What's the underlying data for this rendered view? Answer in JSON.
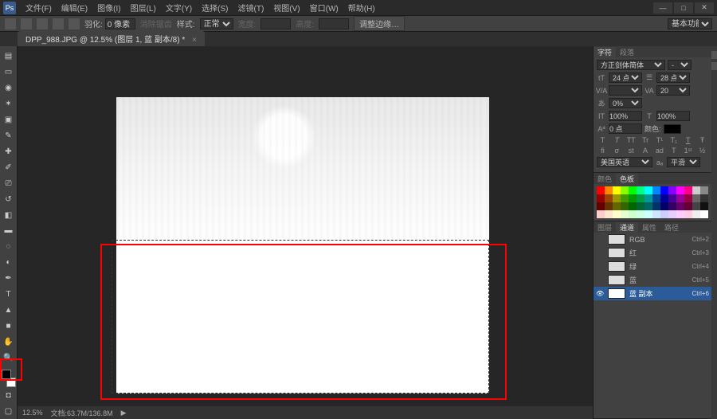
{
  "menu": {
    "logo": "Ps",
    "items": [
      "文件(F)",
      "编辑(E)",
      "图像(I)",
      "图层(L)",
      "文字(Y)",
      "选择(S)",
      "滤镜(T)",
      "视图(V)",
      "窗口(W)",
      "帮助(H)"
    ]
  },
  "optbar": {
    "feather_label": "羽化:",
    "feather_value": "0 像素",
    "anti_alias": "消除锯齿",
    "style_label": "样式:",
    "style_value": "正常",
    "width_label": "宽度:",
    "height_label": "高度:",
    "refine_edge": "调整边缘…",
    "workspace": "基本功能"
  },
  "doc": {
    "title": "DPP_988.JPG @ 12.5% (图层 1, 蓝 副本/8) *"
  },
  "char": {
    "tabs": [
      "字符",
      "段落"
    ],
    "font_family": "方正剑体简体",
    "font_style": "-",
    "size": "24 点",
    "leading": "28 点",
    "tracking": "20",
    "pct": "0%",
    "h_scale": "100%",
    "v_scale": "100%",
    "baseline": "0 点",
    "color_label": "颜色:",
    "lang": "美国英语",
    "aa": "平滑"
  },
  "swatches": {
    "tabs": [
      "颜色",
      "色板"
    ],
    "colors": [
      "#ff0000",
      "#ff8800",
      "#ffff00",
      "#88ff00",
      "#00ff00",
      "#00ff88",
      "#00ffff",
      "#0088ff",
      "#0000ff",
      "#8800ff",
      "#ff00ff",
      "#ff0088",
      "#cccccc",
      "#888888",
      "#990000",
      "#994400",
      "#999900",
      "#449900",
      "#009900",
      "#009944",
      "#009999",
      "#004499",
      "#000099",
      "#440099",
      "#990099",
      "#990044",
      "#666666",
      "#333333",
      "#660000",
      "#663300",
      "#666600",
      "#336600",
      "#006600",
      "#006633",
      "#006666",
      "#003366",
      "#000066",
      "#330066",
      "#660066",
      "#660033",
      "#444444",
      "#111111",
      "#ffcccc",
      "#ffe6cc",
      "#ffffcc",
      "#e6ffcc",
      "#ccffcc",
      "#ccffe6",
      "#ccffff",
      "#cce6ff",
      "#ccccff",
      "#e6ccff",
      "#ffccff",
      "#ffcce6",
      "#eeeeee",
      "#ffffff"
    ]
  },
  "channels": {
    "tabs": [
      "图层",
      "通道",
      "属性",
      "路径"
    ],
    "items": [
      {
        "name": "RGB",
        "shortcut": "Ctrl+2",
        "visible": false,
        "active": false
      },
      {
        "name": "红",
        "shortcut": "Ctrl+3",
        "visible": false,
        "active": false
      },
      {
        "name": "绿",
        "shortcut": "Ctrl+4",
        "visible": false,
        "active": false
      },
      {
        "name": "蓝",
        "shortcut": "Ctrl+5",
        "visible": false,
        "active": false
      },
      {
        "name": "蓝 副本",
        "shortcut": "Ctrl+6",
        "visible": true,
        "active": true
      }
    ]
  },
  "status": {
    "zoom": "12.5%",
    "doc": "文档:63.7M/136.8M"
  }
}
